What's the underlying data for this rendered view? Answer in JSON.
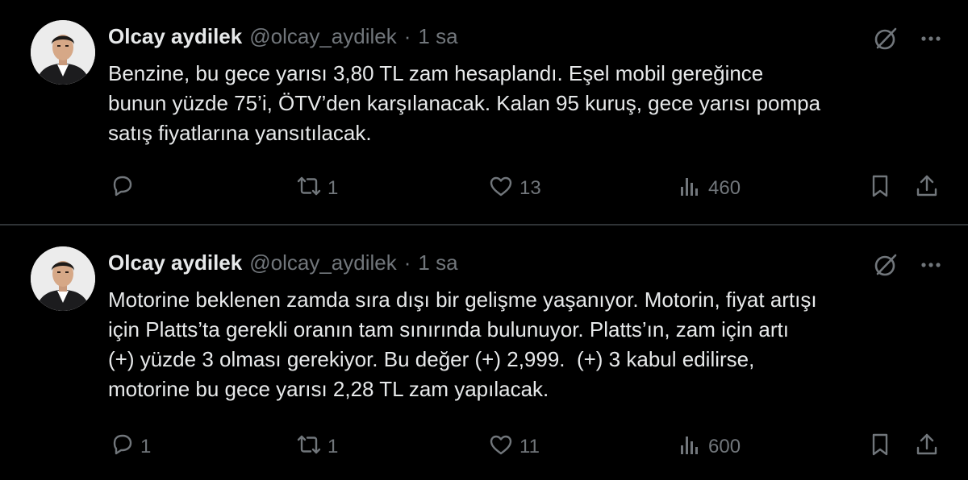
{
  "colors": {
    "background": "#000000",
    "text": "#e7e9ea",
    "secondary": "#71767b",
    "divider": "#2f3336"
  },
  "icons": {
    "reply": "reply-icon",
    "retweet": "retweet-icon",
    "like": "heart-icon",
    "views": "views-icon",
    "bookmark": "bookmark-icon",
    "share": "share-icon",
    "grok": "grok-icon",
    "more": "more-icon"
  },
  "tweets": [
    {
      "name": "Olcay aydilek",
      "handle": "@olcay_aydilek",
      "separator": "·",
      "time": "1 sa",
      "text": "Benzine, bu gece yarısı 3,80 TL zam hesaplandı. Eşel mobil gereğince\nbunun yüzde 75’i, ÖTV’den karşılanacak. Kalan 95 kuruş, gece yarısı pompa\nsatış fiyatlarına yansıtılacak.",
      "replies": "",
      "retweets": "1",
      "likes": "13",
      "views": "460"
    },
    {
      "name": "Olcay aydilek",
      "handle": "@olcay_aydilek",
      "separator": "·",
      "time": "1 sa",
      "text": "Motorine beklenen zamda sıra dışı bir gelişme yaşanıyor. Motorin, fiyat artışı\niçin Platts’ta gerekli oranın tam sınırında bulunuyor. Platts’ın, zam için artı\n(+) yüzde 3 olması gerekiyor. Bu değer (+) 2,999.  (+) 3 kabul edilirse,\nmotorine bu gece yarısı 2,28 TL zam yapılacak.",
      "replies": "1",
      "retweets": "1",
      "likes": "11",
      "views": "600"
    }
  ]
}
